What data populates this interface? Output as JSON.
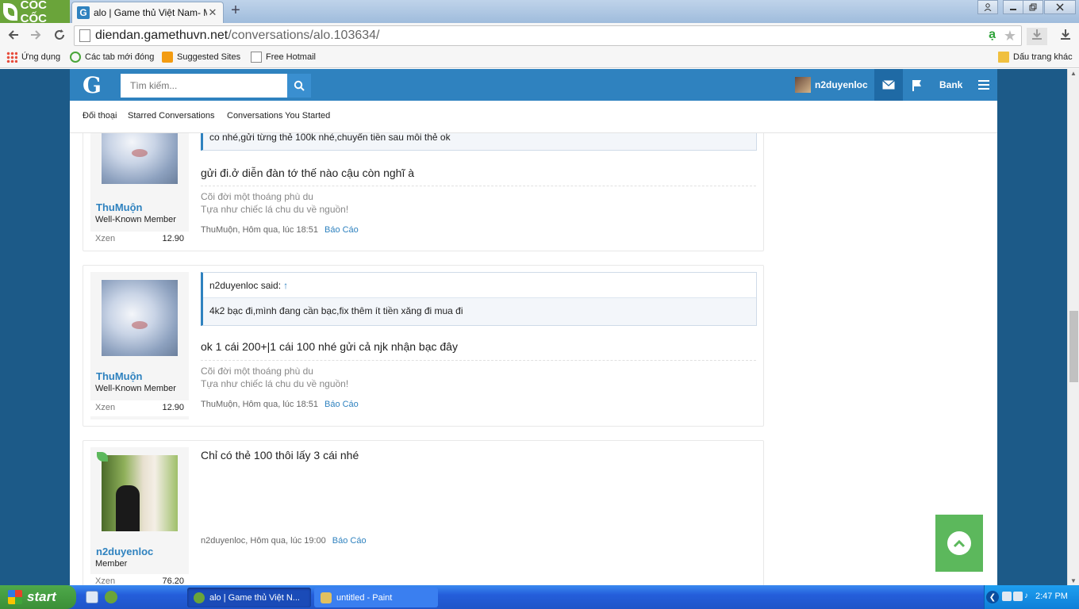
{
  "browser": {
    "brand": "CỐC CỐC",
    "tab_title": "alo | Game thủ Việt Nam- MU",
    "tab_close": "✕",
    "new_tab": "+",
    "url_domain": "diendan.gamethuvn.net",
    "url_path": "/conversations/alo.103634/",
    "bookmarks": [
      "Ứng dụng",
      "Các tab mới đóng",
      "Suggested Sites",
      "Free Hotmail"
    ],
    "other_bookmarks": "Dấu trang khác"
  },
  "forum": {
    "logo": "G",
    "search_placeholder": "Tìm kiếm...",
    "username": "n2duyenloc",
    "bank_label": "Bank",
    "subnav": [
      "Đối thoại",
      "Starred Conversations",
      "Conversations You Started"
    ]
  },
  "messages": [
    {
      "username": "ThuMuộn",
      "usertitle": "Well-Known Member",
      "xzen_label": "Xzen",
      "xzen_value": "12.90",
      "quote_text": "co nhé,gửi từng thẻ 100k nhé,chuyển tiền sau mỗi thẻ ok",
      "text": "gửi đi.ở diễn đàn tớ thế nào cậu còn nghĩ à",
      "sig_line1": "Cõi đời một thoáng phù du",
      "sig_line2": "Tựa như chiếc lá chu du về nguồn!",
      "meta": "ThuMuộn, Hôm qua, lúc 18:51",
      "report": "Báo Cáo"
    },
    {
      "username": "ThuMuộn",
      "usertitle": "Well-Known Member",
      "xzen_label": "Xzen",
      "xzen_value": "12.90",
      "quote_author": "n2duyenloc said:",
      "quote_arrow": "↑",
      "quote_text": "4k2 bạc đi,mình đang cần bạc,fix thêm ít tiền xăng đi mua đi",
      "text": "ok 1 cái 200+|1 cái 100 nhé gửi cả njk nhận bạc đây",
      "sig_line1": "Cõi đời một thoáng phù du",
      "sig_line2": "Tựa như chiếc lá chu du về nguồn!",
      "meta": "ThuMuộn, Hôm qua, lúc 18:51",
      "report": "Báo Cáo"
    },
    {
      "username": "n2duyenloc",
      "usertitle": "Member",
      "xzen_label": "Xzen",
      "xzen_value": "76.20",
      "text": "Chỉ có thẻ 100 thôi lấy 3 cái nhé",
      "meta": "n2duyenloc, Hôm qua, lúc 19:00",
      "report": "Báo Cáo"
    }
  ],
  "taskbar": {
    "start": "start",
    "tasks": [
      "alo | Game thủ Việt N...",
      "untitled - Paint"
    ],
    "clock": "2:47 PM"
  },
  "colors": {
    "forum_blue": "#2f82bf",
    "page_bg": "#1c5a88",
    "back_to_top": "#5cb85c"
  }
}
